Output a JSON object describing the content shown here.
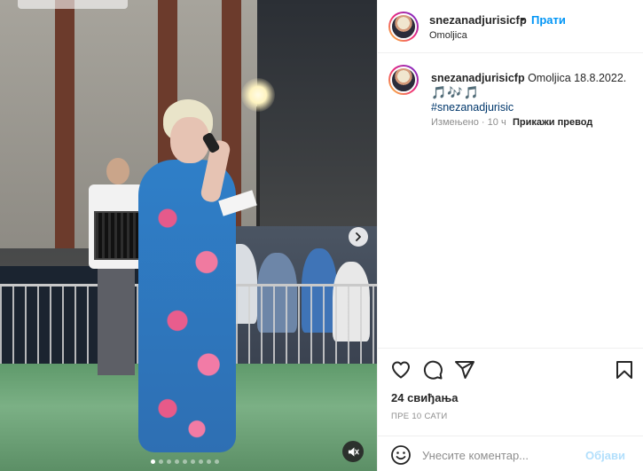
{
  "post": {
    "username": "snezanadjurisicfp",
    "separator": "•",
    "follow_label": "Прати",
    "location": "Omoljica"
  },
  "caption": {
    "username": "snezanadjurisicfp",
    "text": " Omoljica 18.8.2022.",
    "emojis": "🎵🎶🎵",
    "hashtag": "#snezanadjurisic",
    "meta": "Измењено · 10 ч",
    "translate_label": "Прикажи превод"
  },
  "stats": {
    "likes": "24 свиђања",
    "time": "ПРЕ 10 САТИ"
  },
  "comment": {
    "placeholder": "Унесите коментар...",
    "post_label": "Објави"
  },
  "media": {
    "carousel_count": 9,
    "active_index": 0
  },
  "icons": {
    "like": "heart-icon",
    "comment": "comment-icon",
    "share": "share-icon",
    "save": "bookmark-icon",
    "emoji": "smiley-icon",
    "next": "chevron-right-icon",
    "mute": "muted-speaker-icon"
  },
  "colors": {
    "link_blue": "#0095f6",
    "post_disabled": "#b2dffc",
    "muted_text": "#8e8e8e"
  }
}
